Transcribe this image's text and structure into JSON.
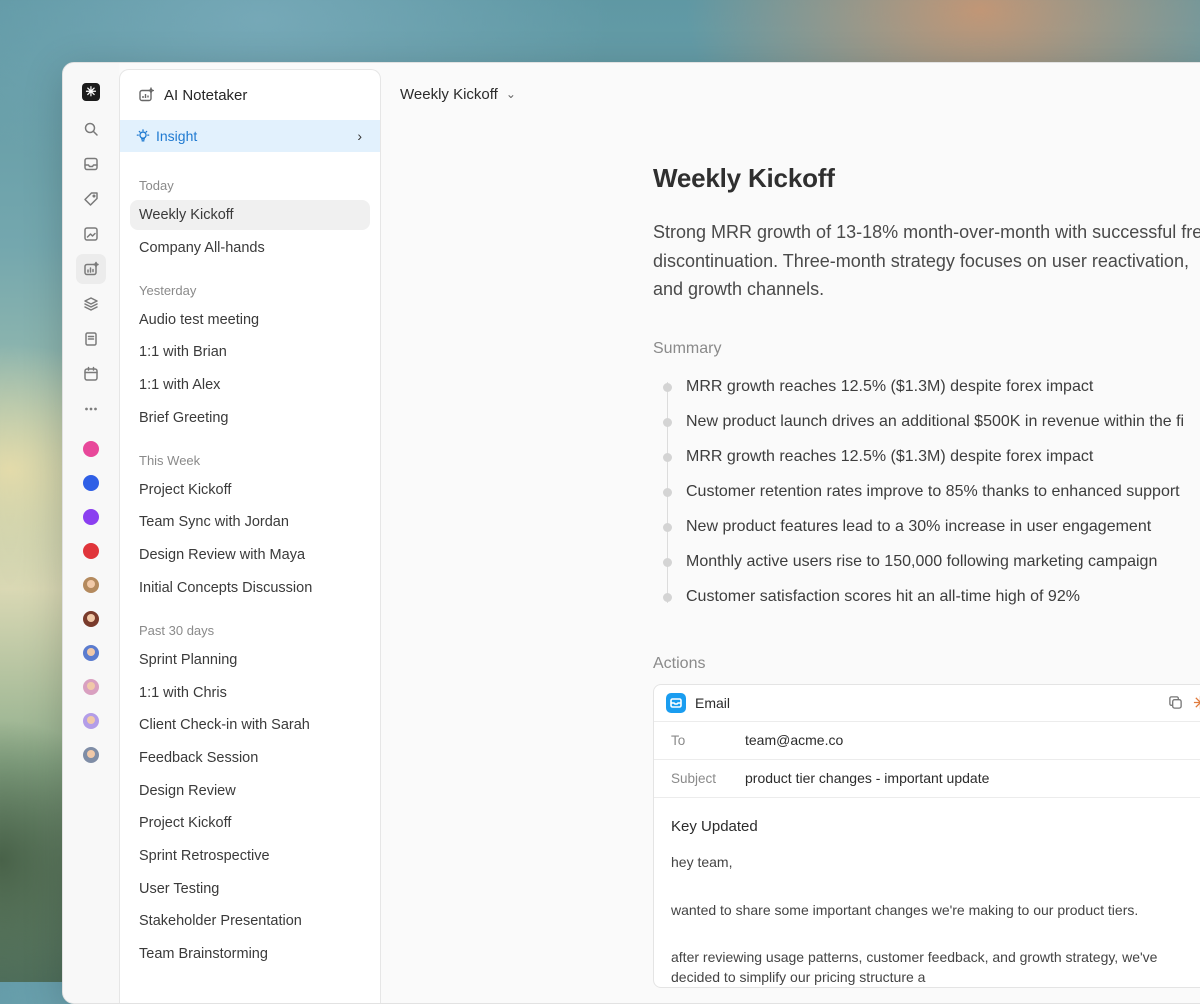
{
  "app": {
    "name": "AI Notetaker"
  },
  "rail": {
    "icons": [
      "search-icon",
      "inbox-icon",
      "tag-icon",
      "image-edit-icon",
      "ai-notetaker-icon",
      "layers-icon",
      "book-icon",
      "calendar-icon",
      "more-icon"
    ],
    "workspace_colors": [
      "#e8489a",
      "#2f5fe6",
      "#8b3ff0",
      "#e0353b"
    ],
    "avatar_colors": [
      "#b48a5e",
      "#7a3b2c",
      "#5b7ccf",
      "#d9a0c0",
      "#b39de8",
      "#7f8da6"
    ]
  },
  "sidebar": {
    "header_label": "AI Notetaker",
    "insight_label": "Insight",
    "groups": [
      {
        "title": "Today",
        "items": [
          "Weekly Kickoff",
          "Company All-hands"
        ]
      },
      {
        "title": "Yesterday",
        "items": [
          "Audio test meeting",
          "1:1 with Brian",
          "1:1 with Alex",
          "Brief Greeting"
        ]
      },
      {
        "title": "This Week",
        "items": [
          "Project Kickoff",
          "Team Sync with Jordan",
          "Design Review with Maya",
          "Initial Concepts Discussion"
        ]
      },
      {
        "title": "Past 30 days",
        "items": [
          "Sprint Planning",
          "1:1 with Chris",
          "Client Check-in with Sarah",
          "Feedback Session",
          "Design Review",
          "Project Kickoff",
          "Sprint Retrospective",
          "User Testing",
          "Stakeholder Presentation",
          "Team Brainstorming"
        ]
      }
    ]
  },
  "main": {
    "breadcrumb": "Weekly Kickoff",
    "title": "Weekly Kickoff",
    "intro_lines": [
      "Strong MRR growth of 13-18% month-over-month with successful fre",
      "discontinuation. Three-month strategy focuses on user reactivation,",
      "and growth channels."
    ],
    "summary_label": "Summary",
    "summary": [
      "MRR growth reaches 12.5% ($1.3M) despite forex impact",
      "New product launch drives an additional $500K in revenue within the fi",
      "MRR growth reaches 12.5% ($1.3M) despite forex impact",
      "Customer retention rates improve to 85% thanks to enhanced support",
      "New product features lead to a 30% increase in user engagement",
      "Monthly active users rise to 150,000 following marketing campaign",
      "Customer satisfaction scores hit an all-time high of 92%"
    ],
    "actions_label": "Actions",
    "email": {
      "card_title": "Email",
      "to_label": "To",
      "to_value": "team@acme.co",
      "subject_label": "Subject",
      "subject_value": "product tier changes - important update",
      "body_title": "Key Updated",
      "greeting": "hey team,",
      "paragraph1": "wanted to share some important changes we're making to our product tiers.",
      "paragraph2": "after reviewing usage patterns, customer feedback, and growth strategy, we've decided to simplify our pricing structure a"
    }
  }
}
